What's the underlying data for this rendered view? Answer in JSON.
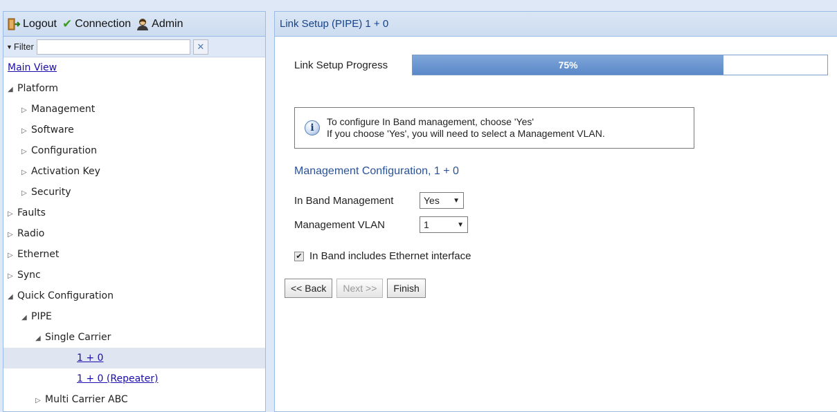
{
  "header": {
    "logout_label": "Logout",
    "connection_label": "Connection",
    "admin_label": "Admin"
  },
  "filter": {
    "label": "Filter",
    "value": "",
    "placeholder": "",
    "clear_icon": "✕"
  },
  "tree": [
    {
      "label": "Main View",
      "level": 0,
      "type": "link"
    },
    {
      "label": "Platform",
      "level": 0,
      "type": "expanded"
    },
    {
      "label": "Management",
      "level": 1,
      "type": "collapsed"
    },
    {
      "label": "Software",
      "level": 1,
      "type": "collapsed"
    },
    {
      "label": "Configuration",
      "level": 1,
      "type": "collapsed"
    },
    {
      "label": "Activation Key",
      "level": 1,
      "type": "collapsed"
    },
    {
      "label": "Security",
      "level": 1,
      "type": "collapsed"
    },
    {
      "label": "Faults",
      "level": 0,
      "type": "collapsed"
    },
    {
      "label": "Radio",
      "level": 0,
      "type": "collapsed"
    },
    {
      "label": "Ethernet",
      "level": 0,
      "type": "collapsed"
    },
    {
      "label": "Sync",
      "level": 0,
      "type": "collapsed"
    },
    {
      "label": "Quick Configuration",
      "level": 0,
      "type": "expanded"
    },
    {
      "label": "PIPE",
      "level": 1,
      "type": "expanded"
    },
    {
      "label": "Single Carrier",
      "level": 2,
      "type": "expanded"
    },
    {
      "label": "1 + 0",
      "level": 3,
      "type": "link",
      "selected": true
    },
    {
      "label": "1 + 0 (Repeater)",
      "level": 3,
      "type": "link"
    },
    {
      "label": "Multi Carrier ABC",
      "level": 2,
      "type": "collapsed"
    }
  ],
  "main": {
    "title": "Link Setup (PIPE) 1 + 0",
    "progress_label": "Link Setup Progress",
    "progress_value": 75,
    "progress_text": "75%",
    "info_line1": "To configure In Band management, choose 'Yes'",
    "info_line2": "If you choose 'Yes', you will need to select a Management VLAN.",
    "section_title": "Management Configuration, 1 + 0",
    "in_band_label": "In Band Management",
    "in_band_value": "Yes",
    "vlan_label": "Management VLAN",
    "vlan_value": "1",
    "checkbox_label": "In Band includes Ethernet interface",
    "checkbox_checked": true,
    "back_label": "<< Back",
    "next_label": "Next >>",
    "finish_label": "Finish"
  },
  "colors": {
    "panel_border": "#99bbe8",
    "header_text": "#15428b",
    "progress_fill": "#5a88c8",
    "link": "#1a0dab",
    "section_title": "#2a5298"
  }
}
